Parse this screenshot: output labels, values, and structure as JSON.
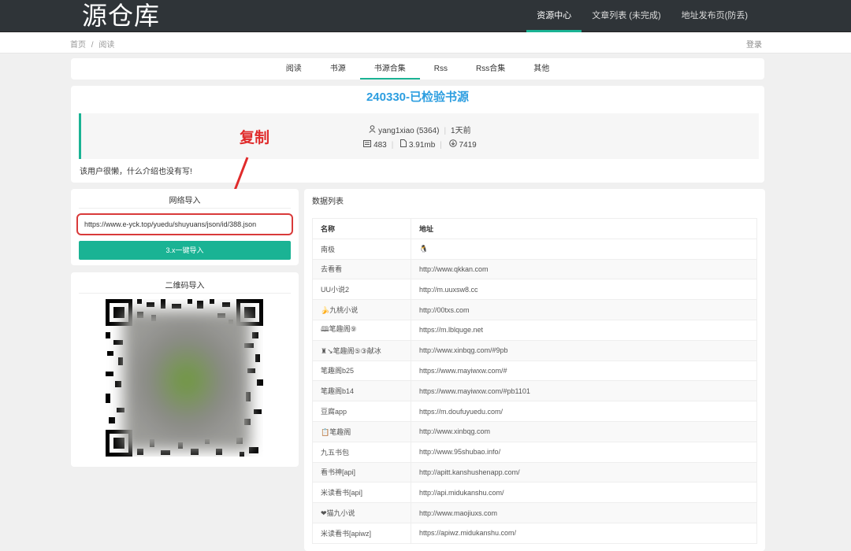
{
  "header": {
    "logo": "源仓库",
    "nav": [
      "资源中心",
      "文章列表 (未完成)",
      "地址发布页(防丢)"
    ]
  },
  "breadcrumb": {
    "home": "首页",
    "sep": "/",
    "current": "阅读",
    "login": "登录"
  },
  "tabs": [
    "阅读",
    "书源",
    "书源合集",
    "Rss",
    "Rss合集",
    "其他"
  ],
  "info": {
    "title": "240330-已检验书源",
    "author": "yang1xiao (5364)",
    "time": "1天前",
    "count": "483",
    "size": "3.91mb",
    "downloads": "7419",
    "description": "该用户很懒，什么介绍也没有写!"
  },
  "annotation": {
    "copy_label": "复制"
  },
  "import": {
    "title": "网络导入",
    "url": "https://www.e-yck.top/yuedu/shuyuans/json/id/388.json",
    "button": "3.x一键导入"
  },
  "qr": {
    "title": "二维码导入"
  },
  "list": {
    "title": "数据列表",
    "col_name": "名称",
    "col_url": "地址",
    "rows": [
      {
        "name": "南极",
        "url": "🐧"
      },
      {
        "name": "去看看",
        "url": "http://www.qkkan.com"
      },
      {
        "name": "UU小说2",
        "url": "http://m.uuxsw8.cc"
      },
      {
        "name": "🍌九桃小说",
        "url": "http://00txs.com"
      },
      {
        "name": "🕮笔趣阁⑨",
        "url": "https://m.lblquge.net"
      },
      {
        "name": "♜↘笔趣阁⑤③献冰",
        "url": "http://www.xinbqg.com/#9pb"
      },
      {
        "name": "笔趣阁b25",
        "url": "https://www.mayiwxw.com/#"
      },
      {
        "name": "笔趣阁b14",
        "url": "https://www.mayiwxw.com/#pb1101"
      },
      {
        "name": "豆腐app",
        "url": "https://m.doufuyuedu.com/"
      },
      {
        "name": "📋笔趣阁",
        "url": "http://www.xinbqg.com"
      },
      {
        "name": "九五书包",
        "url": "http://www.95shubao.info/"
      },
      {
        "name": "看书神[api]",
        "url": "http://apitt.kanshushenapp.com/"
      },
      {
        "name": "米读看书[api]",
        "url": "http://api.midukanshu.com/"
      },
      {
        "name": "❤猫九小说",
        "url": "http://www.maojiuxs.com"
      },
      {
        "name": "米读看书[apiwz]",
        "url": "https://apiwz.midukanshu.com/"
      }
    ]
  }
}
